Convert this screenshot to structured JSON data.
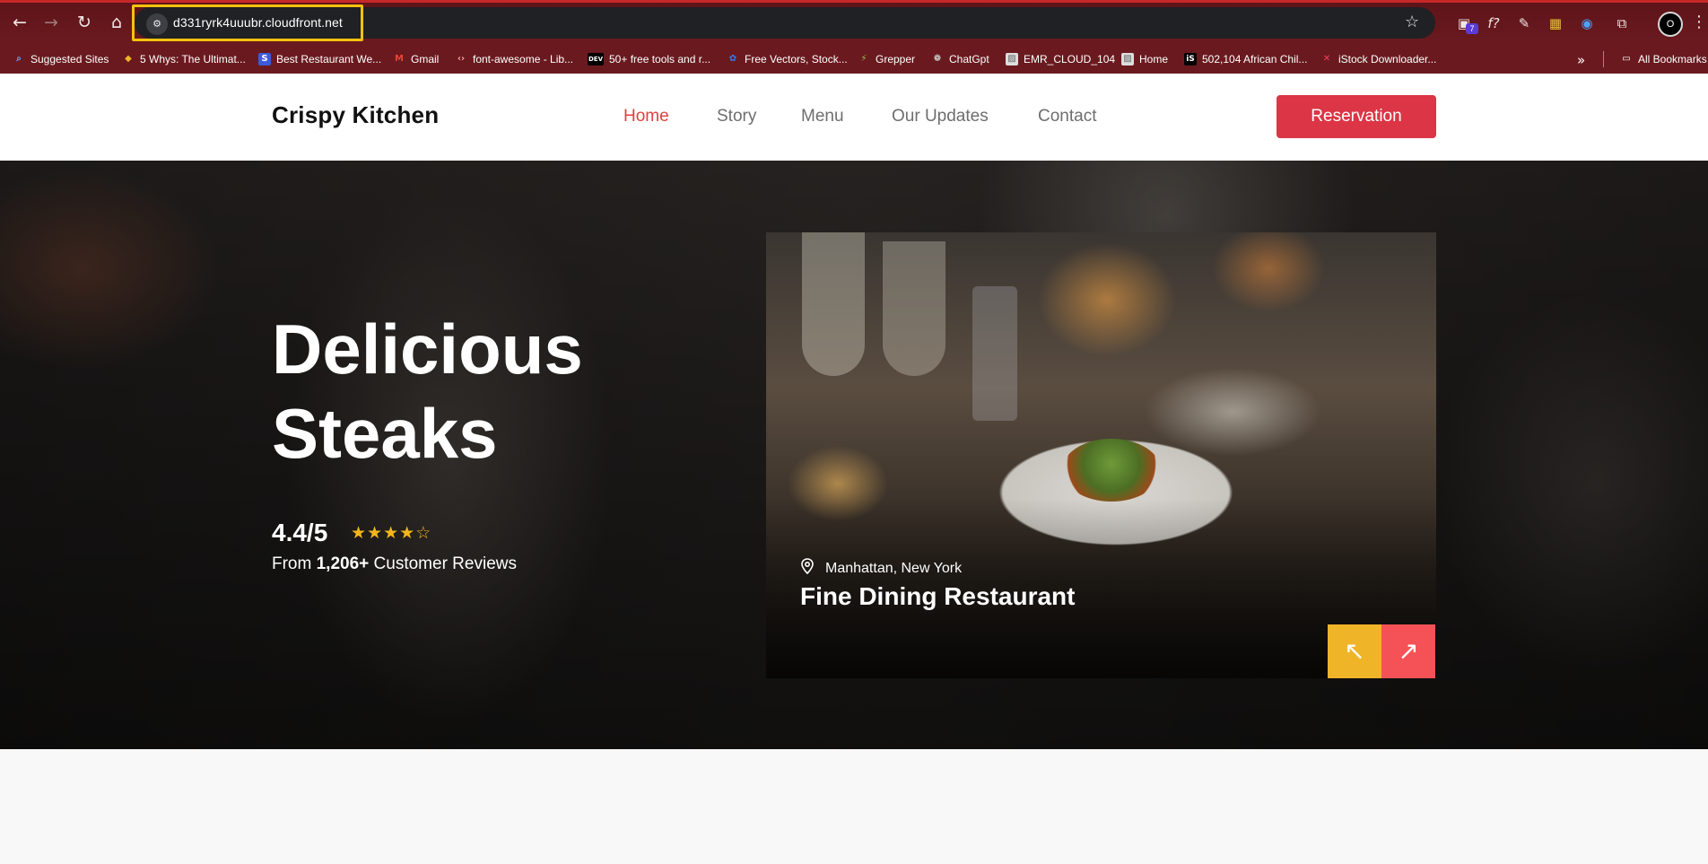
{
  "browser": {
    "url": "d331ryrk4uuubr.cloudfront.net",
    "extension_badge": "7",
    "profile_initial": "O",
    "bookmarks": [
      {
        "label": "Suggested Sites",
        "icon": "magnifier-icon"
      },
      {
        "label": "5 Whys: The Ultimat...",
        "icon": "colorful-diamond-icon"
      },
      {
        "label": "Best Restaurant We...",
        "icon": "s-logo-icon"
      },
      {
        "label": "Gmail",
        "icon": "gmail-icon"
      },
      {
        "label": "font-awesome - Lib...",
        "icon": "code-brackets-icon"
      },
      {
        "label": "50+ free tools and r...",
        "icon": "dev-icon"
      },
      {
        "label": "Free Vectors, Stock...",
        "icon": "freepik-icon"
      },
      {
        "label": "Grepper",
        "icon": "grepper-icon"
      },
      {
        "label": "ChatGpt",
        "icon": "chatgpt-icon"
      },
      {
        "label": "EMR_CLOUD_104",
        "icon": "grid-icon"
      },
      {
        "label": "Home",
        "icon": "grid-icon"
      },
      {
        "label": "502,104 African Chil...",
        "icon": "istock-icon"
      },
      {
        "label": "iStock Downloader...",
        "icon": "k-logo-icon"
      }
    ],
    "all_bookmarks": "All Bookmarks"
  },
  "site": {
    "brand": "Crispy Kitchen",
    "nav": [
      "Home",
      "Story",
      "Menu",
      "Our Updates",
      "Contact"
    ],
    "active_nav": "Home",
    "reservation": "Reservation"
  },
  "hero": {
    "title_line1": "Delicious",
    "title_line2": "Steaks",
    "rating": "4.4/5",
    "stars_filled": 4,
    "stars_total": 5,
    "reviews_prefix": "From ",
    "reviews_count": "1,206+",
    "reviews_suffix": " Customer Reviews"
  },
  "card": {
    "location": "Manhattan, New York",
    "title": "Fine Dining Restaurant",
    "prev_icon": "arrow-up-left-icon",
    "next_icon": "arrow-up-right-icon"
  },
  "colors": {
    "accent_red": "#dc3545",
    "active_nav": "#e0413f",
    "star_yellow": "#f4b61a",
    "prev_button": "#f0b429",
    "next_button": "#f45256",
    "url_highlight": "#f4c20d"
  }
}
